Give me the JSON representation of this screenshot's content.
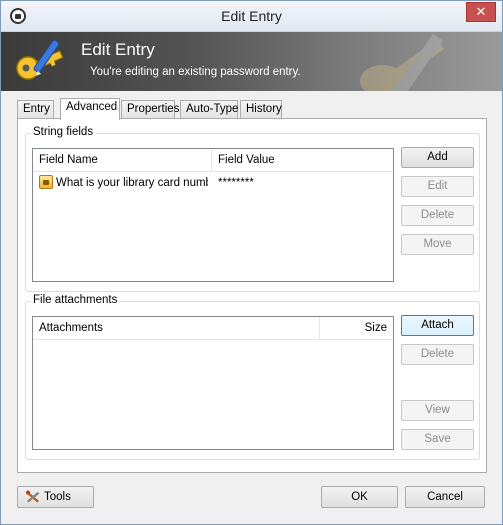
{
  "window": {
    "title": "Edit Entry",
    "close_glyph": "✕"
  },
  "banner": {
    "title": "Edit Entry",
    "subtitle": "You're editing an existing password entry.",
    "icon": "key-pen-icon"
  },
  "tabs": [
    {
      "label": "Entry",
      "active": false
    },
    {
      "label": "Advanced",
      "active": true
    },
    {
      "label": "Properties",
      "active": false
    },
    {
      "label": "Auto-Type",
      "active": false
    },
    {
      "label": "History",
      "active": false
    }
  ],
  "string_fields": {
    "group_label": "String fields",
    "columns": [
      "Field Name",
      "Field Value"
    ],
    "rows": [
      {
        "name": "What is your library card numb...",
        "value": "********"
      }
    ],
    "buttons": {
      "add": "Add",
      "edit": "Edit",
      "delete": "Delete",
      "move": "Move"
    }
  },
  "file_attachments": {
    "group_label": "File attachments",
    "columns": [
      "Attachments",
      "Size"
    ],
    "rows": [],
    "buttons": {
      "attach": "Attach",
      "delete": "Delete",
      "view": "View",
      "save": "Save"
    }
  },
  "footer": {
    "tools": "Tools",
    "ok": "OK",
    "cancel": "Cancel"
  },
  "colors": {
    "accent": "#3c7fb1",
    "banner_dark": "#3a3a3a"
  }
}
